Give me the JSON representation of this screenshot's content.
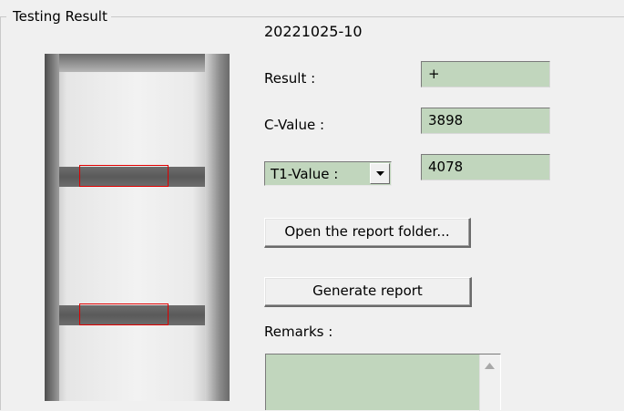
{
  "group": {
    "title": "Testing Result"
  },
  "sample": {
    "id": "20221025-10"
  },
  "fields": {
    "result_label": "Result :",
    "result_value": "+",
    "c_label": "C-Value :",
    "c_value": "3898",
    "t_select_value": "T1-Value :",
    "t_value": "4078",
    "remarks_label": "Remarks :",
    "remarks_value": ""
  },
  "buttons": {
    "open_folder": "Open the report folder...",
    "generate": "Generate report"
  },
  "colors": {
    "field_background": "#c1d6bd",
    "roi_box": "#e00000",
    "window_background": "#f0f0f0"
  },
  "icons": {
    "combo_arrow": "chevron-down-icon",
    "scroll_up": "scroll-up-arrow-icon"
  }
}
